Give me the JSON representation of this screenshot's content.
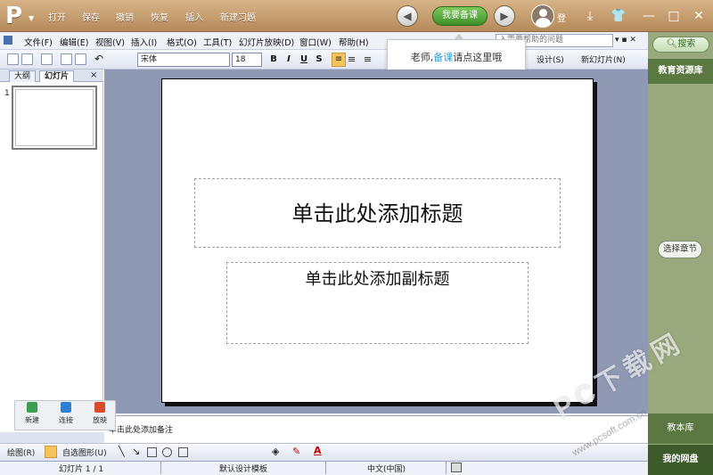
{
  "titlebar": {
    "logo": "P",
    "buttons": [
      "打开",
      "保存",
      "撤销",
      "恢复",
      "插入",
      "新建习题"
    ],
    "prepare": "我要备课",
    "login": "登",
    "icons": [
      "download-icon",
      "shirt-icon",
      "minimize-icon",
      "maximize-icon",
      "close-icon"
    ]
  },
  "menubar": {
    "items": [
      "文件(F)",
      "编辑(E)",
      "视图(V)",
      "插入(I)",
      "格式(O)",
      "工具(T)",
      "幻灯片放映(D)",
      "窗口(W)",
      "帮助(H)"
    ],
    "help_placeholder": "入需要帮助的问题"
  },
  "toolbar": {
    "font": "宋体",
    "size": "18",
    "bold": "B",
    "italic": "I",
    "underline": "U",
    "strike": "S",
    "design": "设计(S)",
    "new_slide": "新幻灯片(N)"
  },
  "tooltip": {
    "prefix": "老师,",
    "highlight": "备课",
    "suffix": "请点这里哦"
  },
  "leftpanel": {
    "tabs": [
      "大纲",
      "幻灯片"
    ],
    "close": "×",
    "slide_number": "1"
  },
  "slide": {
    "title_placeholder": "单击此处添加标题",
    "subtitle_placeholder": "单击此处添加副标题"
  },
  "notes": {
    "placeholder": "单击此处添加备注"
  },
  "floatpanel": {
    "items": [
      "新建",
      "连接",
      "放映"
    ]
  },
  "drawbar": {
    "draw": "绘图(R)",
    "autoshapes": "自选图形(U)"
  },
  "status": {
    "slide": "幻灯片 1 / 1",
    "template": "默认设计模板",
    "language": "中文(中国)"
  },
  "right": {
    "search": "搜索",
    "title": "教育资源库",
    "chapter": "选择章节",
    "bottom1": "教本库",
    "bottom2": "我的网盘"
  },
  "watermark": {
    "line1": "PC下载网",
    "line2": "www.pcsoft.com.cn"
  }
}
